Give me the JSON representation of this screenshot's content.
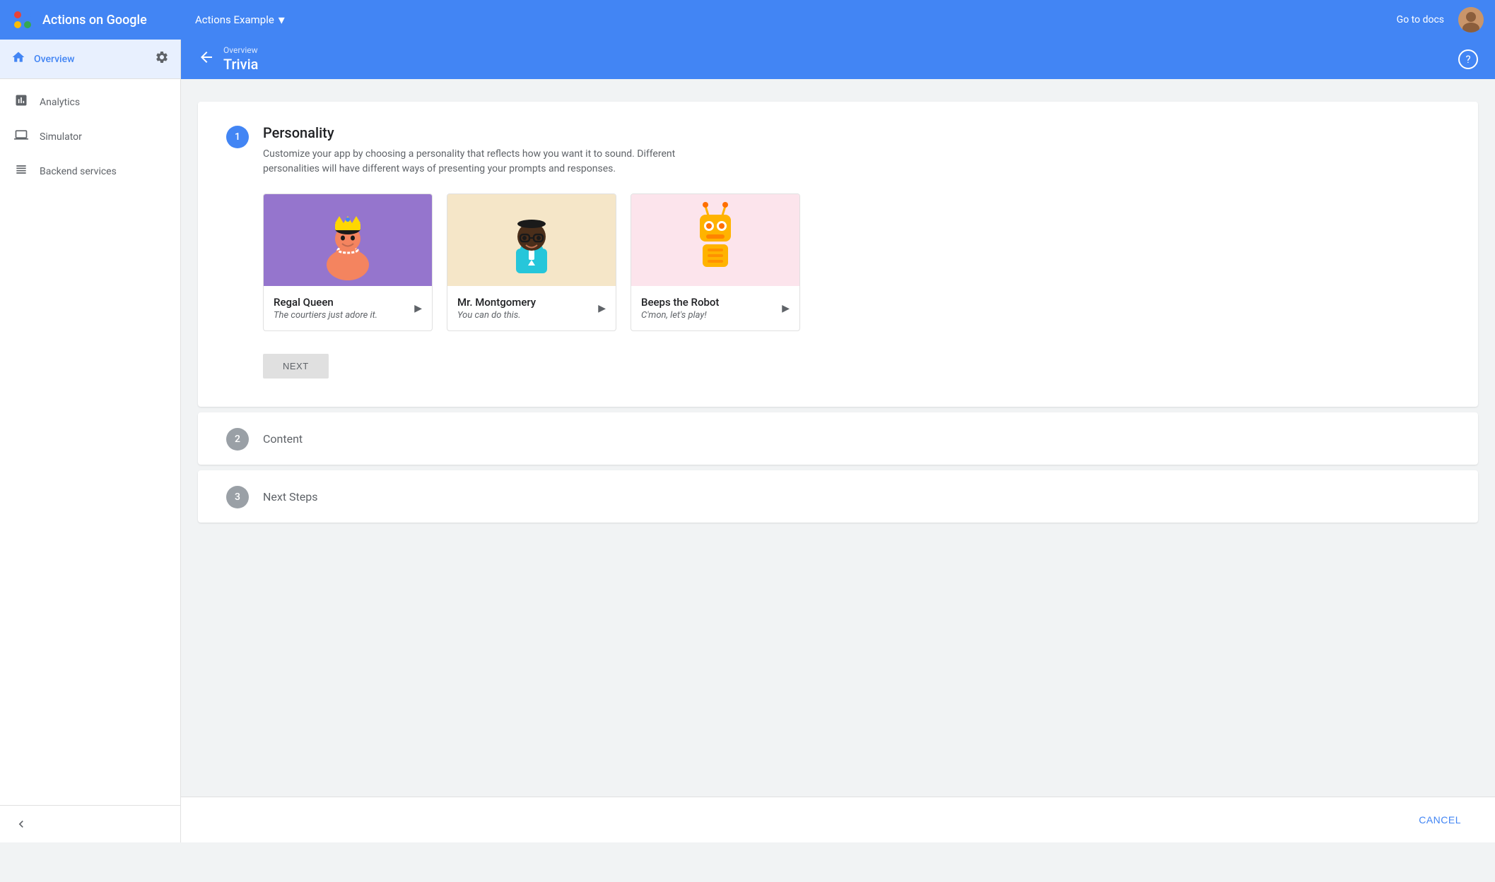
{
  "app": {
    "name": "Actions on Google",
    "project": "Actions Example"
  },
  "header": {
    "go_to_docs": "Go to docs",
    "dropdown_label": "Actions Example"
  },
  "sidebar": {
    "overview_label": "Overview",
    "items": [
      {
        "id": "analytics",
        "label": "Analytics",
        "icon": "chart-bar"
      },
      {
        "id": "simulator",
        "label": "Simulator",
        "icon": "monitor"
      },
      {
        "id": "backend-services",
        "label": "Backend services",
        "icon": "grid"
      }
    ],
    "collapse_label": "Collapse"
  },
  "sub_header": {
    "breadcrumb": "Overview",
    "title": "Trivia",
    "back_label": "back"
  },
  "personality_section": {
    "step_number": "1",
    "title": "Personality",
    "description": "Customize your app by choosing a personality that reflects how you want it to sound. Different personalities will have different ways of presenting your prompts and responses.",
    "cards": [
      {
        "id": "regal-queen",
        "name": "Regal Queen",
        "tagline": "The courtiers just adore it.",
        "bg_color": "#9575cd",
        "character": "queen"
      },
      {
        "id": "mr-montgomery",
        "name": "Mr. Montgomery",
        "tagline": "You can do this.",
        "bg_color": "#f5e6c8",
        "character": "montgomery"
      },
      {
        "id": "beeps-robot",
        "name": "Beeps the Robot",
        "tagline": "C'mon, let's play!",
        "bg_color": "#fce4ec",
        "character": "robot"
      }
    ],
    "next_button": "NEXT"
  },
  "content_section": {
    "step_number": "2",
    "title": "Content"
  },
  "next_steps_section": {
    "step_number": "3",
    "title": "Next Steps"
  },
  "footer": {
    "cancel_label": "CANCEL"
  }
}
